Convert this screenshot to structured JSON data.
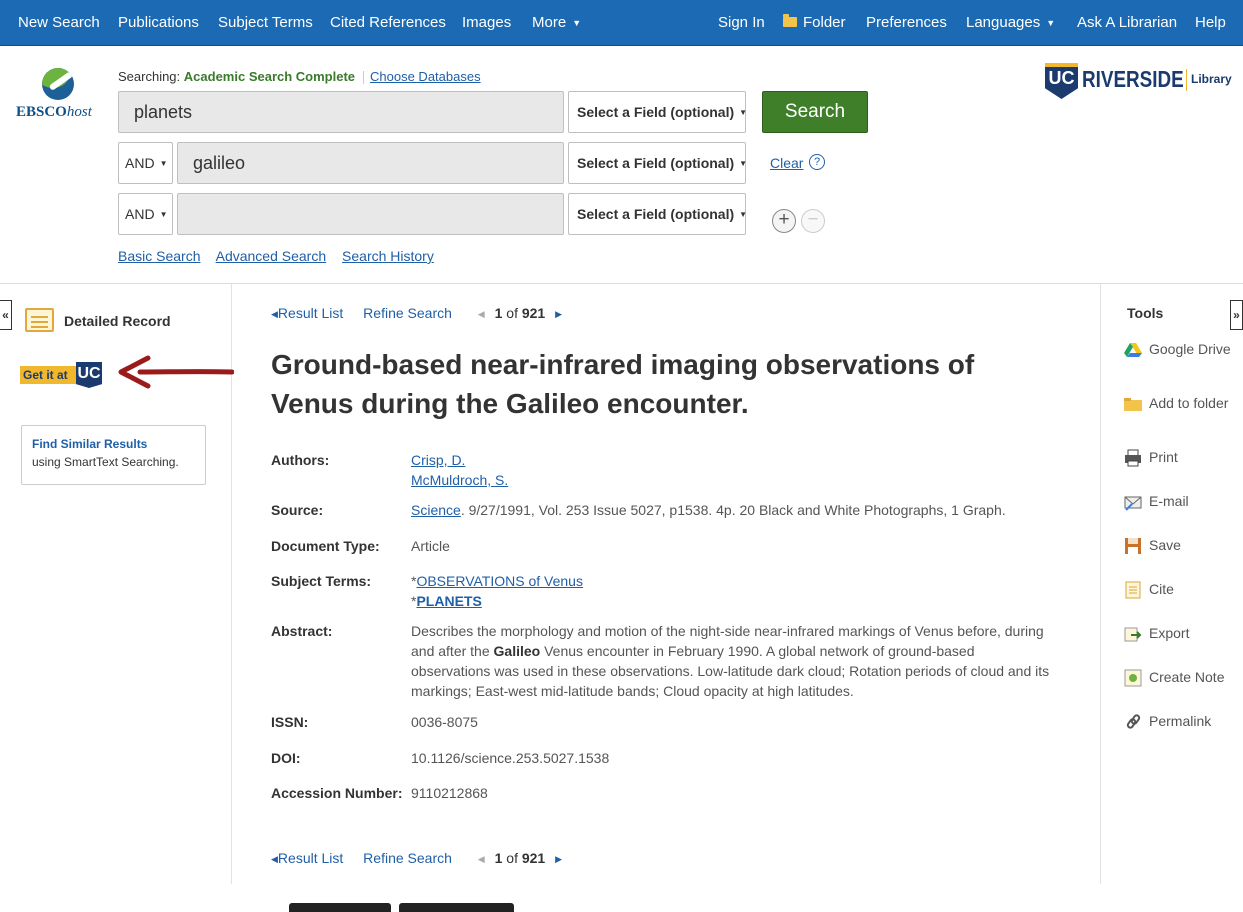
{
  "nav": {
    "new_search": "New Search",
    "publications": "Publications",
    "subject_terms": "Subject Terms",
    "cited_references": "Cited References",
    "images": "Images",
    "more": "More",
    "sign_in": "Sign In",
    "folder": "Folder",
    "preferences": "Preferences",
    "languages": "Languages",
    "ask_librarian": "Ask A Librarian",
    "help": "Help"
  },
  "logo": {
    "brand": "EBSCO",
    "suffix": "host"
  },
  "search": {
    "searching_label": "Searching:",
    "database": "Academic Search Complete",
    "choose_databases": "Choose Databases",
    "rows": [
      {
        "bool": "",
        "term": "planets",
        "field": "Select a Field (optional)"
      },
      {
        "bool": "AND",
        "term": "galileo",
        "field": "Select a Field (optional)"
      },
      {
        "bool": "AND",
        "term": "",
        "field": "Select a Field (optional)"
      }
    ],
    "search_button": "Search",
    "clear": "Clear",
    "help_glyph": "?",
    "plus_glyph": "+",
    "minus_glyph": "−",
    "links": [
      "Basic Search",
      "Advanced Search",
      "Search History"
    ]
  },
  "library_logo": {
    "mark": "UC",
    "name": "RIVERSIDE",
    "suffix": "Library"
  },
  "left": {
    "collapse": "«",
    "detailed_record": "Detailed Record",
    "getit_text": "Get it at",
    "getit_mark": "UC",
    "similar_title": "Find Similar Results",
    "similar_sub": "using SmartText Searching."
  },
  "pager": {
    "result_list": "Result List",
    "refine_search": "Refine Search",
    "current": "1",
    "of": "of",
    "total": "921"
  },
  "record": {
    "title": "Ground-based near-infrared imaging observations of Venus during the Galileo encounter.",
    "labels": {
      "authors": "Authors:",
      "source": "Source:",
      "doc_type": "Document Type:",
      "subject_terms": "Subject Terms:",
      "abstract": "Abstract:",
      "issn": "ISSN:",
      "doi": "DOI:",
      "accession": "Accession Number:"
    },
    "authors": [
      "Crisp, D.",
      "McMuldroch, S."
    ],
    "source_journal": "Science",
    "source_rest": ". 9/27/1991, Vol. 253 Issue 5027, p1538. 4p. 20 Black and White Photographs, 1 Graph.",
    "doc_type": "Article",
    "subjects": [
      "OBSERVATIONS of Venus",
      "PLANETS"
    ],
    "subject_prefix": "*",
    "abstract_pre": "Describes the morphology and motion of the night-side near-infrared markings of Venus before, during and after the ",
    "abstract_bold": "Galileo",
    "abstract_post": " Venus encounter in February 1990. A global network of ground-based observations was used in these observations. Low-latitude dark cloud; Rotation periods of cloud and its markings; East-west mid-latitude bands; Cloud opacity at high latitudes.",
    "issn": "0036-8075",
    "doi": "10.1126/science.253.5027.1538",
    "accession": "9110212868"
  },
  "tools": {
    "heading": "Tools",
    "expand": "»",
    "items": [
      {
        "label": "Google Drive",
        "icon": "google-drive-icon"
      },
      {
        "label": "Add to folder",
        "icon": "folder-icon"
      },
      {
        "label": "Print",
        "icon": "printer-icon"
      },
      {
        "label": "E-mail",
        "icon": "email-icon"
      },
      {
        "label": "Save",
        "icon": "save-icon"
      },
      {
        "label": "Cite",
        "icon": "cite-icon"
      },
      {
        "label": "Export",
        "icon": "export-icon"
      },
      {
        "label": "Create Note",
        "icon": "note-icon"
      },
      {
        "label": "Permalink",
        "icon": "link-icon"
      }
    ]
  },
  "colors": {
    "nav": "#1b6ab3",
    "search_button": "#3f7f2a",
    "link": "#1f5fa8",
    "uc_gold": "#f1b82d",
    "uc_blue": "#1b3b6f"
  }
}
